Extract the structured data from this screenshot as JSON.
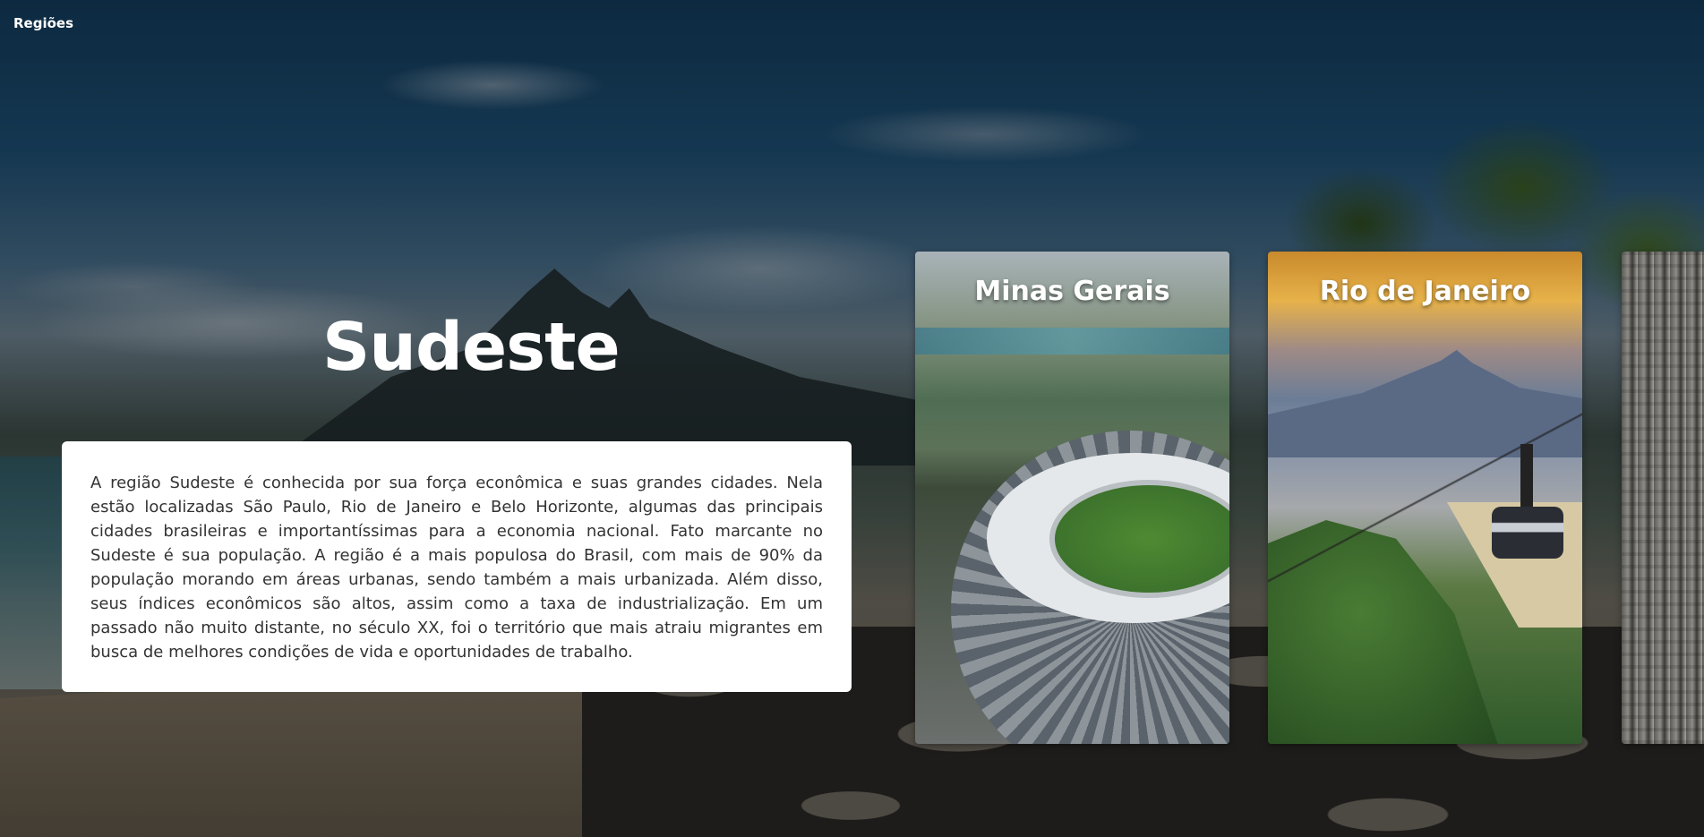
{
  "nav": {
    "regions_label": "Regiões"
  },
  "region": {
    "title": "Sudeste",
    "description": "A região Sudeste é conhecida por sua força econômica e suas grandes cidades. Nela estão localizadas São Paulo, Rio de Janeiro e Belo Horizonte, algumas das principais cidades brasileiras e importantíssimas para a economia nacional. Fato marcante no Sudeste é sua população. A região é a mais populosa do Brasil, com mais de 90% da população morando em áreas urbanas, sendo também a mais urbanizada. Além disso, seus índices econômicos são altos, assim como a taxa de industrialização. Em um passado não muito distante, no século XX, foi o território que mais atraiu migrantes em busca de melhores condições de vida e oportunidades de trabalho."
  },
  "cards": [
    {
      "label": "Minas Gerais",
      "image": "mineirao-stadium-photo"
    },
    {
      "label": "Rio de Janeiro",
      "image": "sugarloaf-cable-car-photo"
    },
    {
      "label": "",
      "image": "city-aerial-photo"
    }
  ],
  "background": {
    "image": "ipanema-beach-photo"
  }
}
